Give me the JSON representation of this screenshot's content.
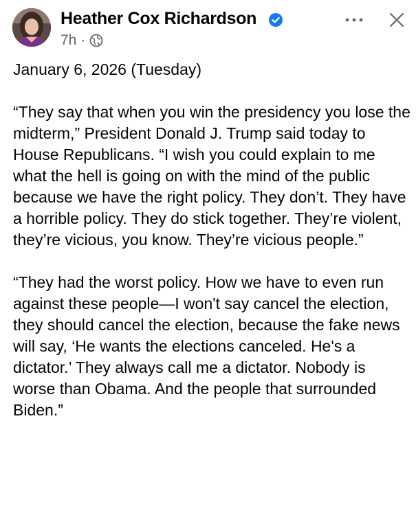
{
  "post": {
    "author": {
      "name": "Heather Cox Richardson",
      "verified": true,
      "avatar": "avatar-photo"
    },
    "meta": {
      "time": "7h",
      "separator": "·",
      "audience_icon": "globe-icon"
    },
    "actions": {
      "more_icon": "more-options-icon",
      "close_icon": "close-icon"
    },
    "date_line": "January 6, 2026 (Tuesday)",
    "paragraphs": [
      "“They say that when you win the presidency you lose the midterm,” President Donald J. Trump said today to House Republicans. “I wish you could explain to me what the hell is going on with the mind of the public because we have the right policy. They don’t. They have a horrible policy. They do stick together. They’re violent, they’re vicious, you know. They’re vicious people.”",
      "“They had the worst policy. How we have to even run against these people—I won't say cancel the election, they should cancel the election, because the fake news will say, ‘He wants the elections canceled. He's a dictator.’ They always call me a dictator. Nobody is worse than Obama. And the people that surrounded Biden.”"
    ]
  },
  "colors": {
    "text": "#050505",
    "secondary": "#65676b",
    "verified": "#1877f2",
    "background": "#ffffff"
  }
}
